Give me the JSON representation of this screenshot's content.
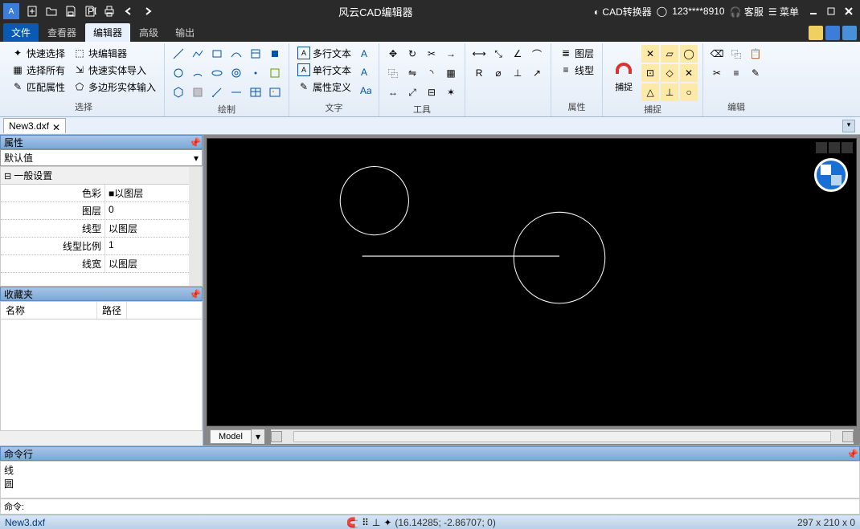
{
  "titlebar": {
    "app_title": "风云CAD编辑器",
    "converter": "CAD转换器",
    "user": "123****8910",
    "service": "客服",
    "menu": "菜单"
  },
  "tabs": {
    "file": "文件",
    "viewer": "查看器",
    "editor": "编辑器",
    "advanced": "高级",
    "output": "输出"
  },
  "ribbon": {
    "select": {
      "label": "选择",
      "quick": "快速选择",
      "all": "选择所有",
      "match": "匹配属性",
      "blockedit": "块编辑器",
      "fastimport": "快速实体导入",
      "polyinput": "多边形实体输入"
    },
    "draw": {
      "label": "绘制"
    },
    "text": {
      "label": "文字",
      "multi": "多行文本",
      "single": "单行文本",
      "attr": "属性定义"
    },
    "tools": {
      "label": "工具"
    },
    "props": {
      "label": "属性",
      "layer": "图层",
      "linetype": "线型"
    },
    "snap": {
      "label": "捕捉",
      "btn": "捕捉"
    },
    "edit": {
      "label": "编辑"
    }
  },
  "doc": {
    "name": "New3.dxf"
  },
  "prop_panel": {
    "title": "属性",
    "default": "默认值",
    "section": "一般设置",
    "rows": [
      {
        "k": "色彩",
        "v": "■以图层"
      },
      {
        "k": "图层",
        "v": "0"
      },
      {
        "k": "线型",
        "v": "以图层"
      },
      {
        "k": "线型比例",
        "v": "1"
      },
      {
        "k": "线宽",
        "v": "以图层"
      }
    ]
  },
  "fav": {
    "title": "收藏夹",
    "name": "名称",
    "path": "路径"
  },
  "model": {
    "tab": "Model"
  },
  "cmd": {
    "title": "命令行",
    "hist1": "线",
    "hist2": "圆",
    "prompt": "命令:"
  },
  "status": {
    "file": "New3.dxf",
    "coord": "(16.14285; -2.86707; 0)",
    "print": "297 x 210 x 0"
  }
}
